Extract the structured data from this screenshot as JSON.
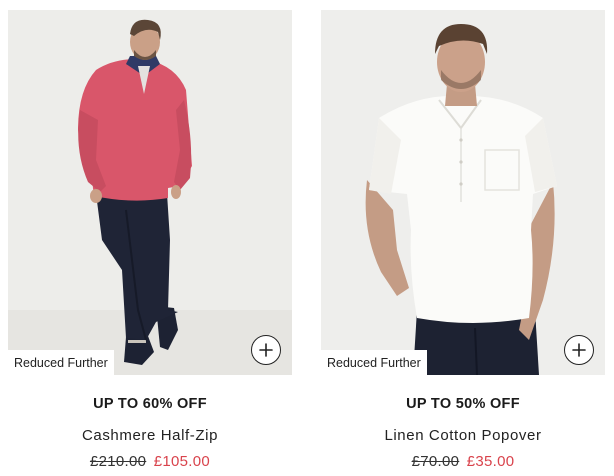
{
  "products": [
    {
      "badge": "Reduced Further",
      "promo": "UP TO 60% OFF",
      "name": "Cashmere Half-Zip",
      "was_price": "£210.00",
      "now_price": "£105.00",
      "quick_add_icon": "plus-icon",
      "colors": {
        "background": "#ededea",
        "top": "#d9566a",
        "trousers": "#1f2436"
      }
    },
    {
      "badge": "Reduced Further",
      "promo": "UP TO 50% OFF",
      "name": "Linen Cotton Popover",
      "was_price": "£70.00",
      "now_price": "£35.00",
      "quick_add_icon": "plus-icon",
      "colors": {
        "background": "#eeeeec",
        "top": "#fbfbf9",
        "trousers": "#1d2232"
      }
    }
  ],
  "accent_sale_color": "#d9434c"
}
